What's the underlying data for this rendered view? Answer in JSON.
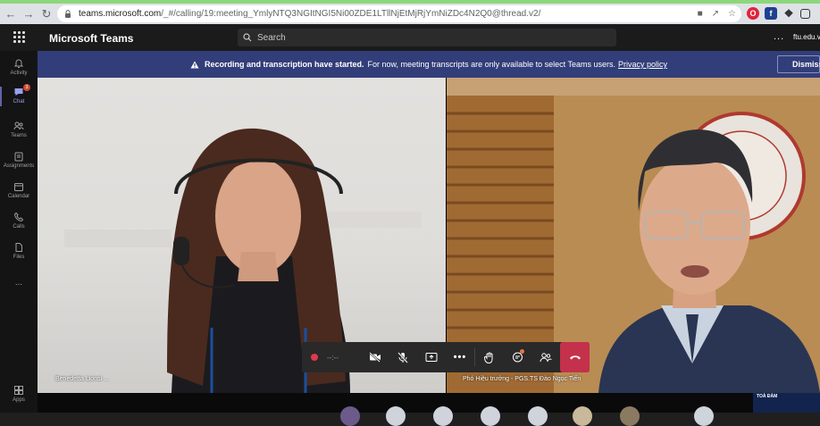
{
  "browser": {
    "url_host": "teams.microsoft.com",
    "url_path": "/_#/calling/19:meeting_YmlyNTQ3NGItNGI5Ni00ZDE1LTllNjEtMjRjYmNiZDc4N2Q0@thread.v2/"
  },
  "header": {
    "app_name": "Microsoft Teams",
    "search_placeholder": "Search",
    "more_label": "...",
    "tenant": "ftu.edu.v"
  },
  "rail": {
    "items": [
      {
        "label": "Activity",
        "icon": "bell-icon"
      },
      {
        "label": "Chat",
        "icon": "chat-icon",
        "badge": "3"
      },
      {
        "label": "Teams",
        "icon": "teams-icon"
      },
      {
        "label": "Assignments",
        "icon": "assignments-icon"
      },
      {
        "label": "Calendar",
        "icon": "calendar-icon"
      },
      {
        "label": "Calls",
        "icon": "phone-icon"
      },
      {
        "label": "Files",
        "icon": "file-icon"
      },
      {
        "label": "...",
        "icon": "more-icon"
      },
      {
        "label": "Apps",
        "icon": "apps-icon"
      }
    ]
  },
  "banner": {
    "bold_text": "Recording and transcription have started.",
    "text": "For now, meeting transcripts are only available to select Teams users.",
    "link_text": "Privacy policy",
    "dismiss_label": "Dismiss"
  },
  "participants": {
    "left_name": "Benedetta Lionsi ...",
    "right_name": "Phó Hiệu trưởng - PGS.TS Đào Ngọc Tiến"
  },
  "controls": {
    "timer": "--:--",
    "colors": {
      "record": "#e03a4a",
      "hangup": "#c4314b"
    }
  },
  "thumbnail": {
    "text": "TOÀ ĐÀM"
  },
  "colors": {
    "banner": "#323e79",
    "accent": "#6264a7"
  }
}
